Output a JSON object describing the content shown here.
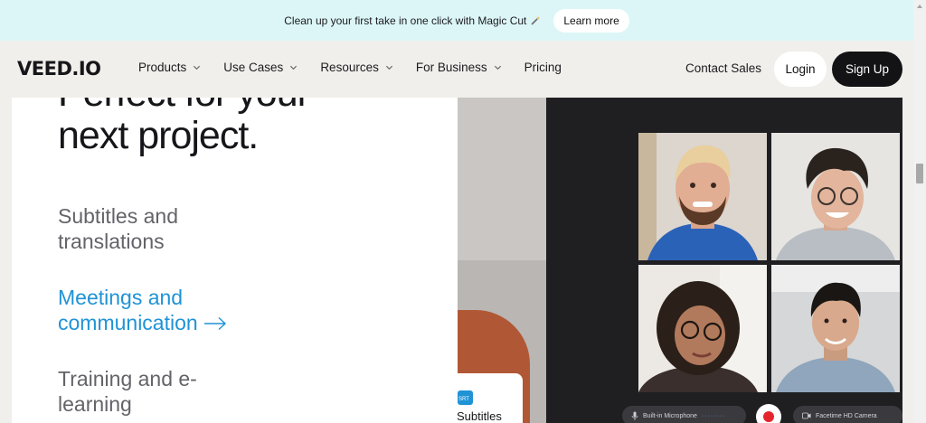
{
  "announcement": {
    "text": "Clean up your first take in one click with Magic Cut",
    "icon": "magic-wand-icon",
    "cta": "Learn more"
  },
  "nav": {
    "logo": "VEED.IO",
    "items": [
      {
        "label": "Products",
        "has_dropdown": true
      },
      {
        "label": "Use Cases",
        "has_dropdown": true
      },
      {
        "label": "Resources",
        "has_dropdown": true
      },
      {
        "label": "For Business",
        "has_dropdown": true
      },
      {
        "label": "Pricing",
        "has_dropdown": false
      }
    ],
    "contact": "Contact Sales",
    "login": "Login",
    "signup": "Sign Up"
  },
  "hero": {
    "headline_line1": "Perfect for your",
    "headline_line2": "next project."
  },
  "features": [
    {
      "line1": "Subtitles and",
      "line2": "translations",
      "active": false
    },
    {
      "line1": "Meetings and",
      "line2": "communication",
      "active": true
    },
    {
      "line1": "Training and e-",
      "line2": "learning",
      "active": false
    }
  ],
  "media": {
    "subtitle_card_label": "Subtitles",
    "mic_label": "Built-in Microphone",
    "camera_label": "Facetime HD Camera"
  },
  "colors": {
    "announcement_bg": "#dcf6f7",
    "page_bg": "#f1efeb",
    "accent_blue": "#1f93d6",
    "dark": "#131316",
    "record_red": "#e5252c"
  }
}
